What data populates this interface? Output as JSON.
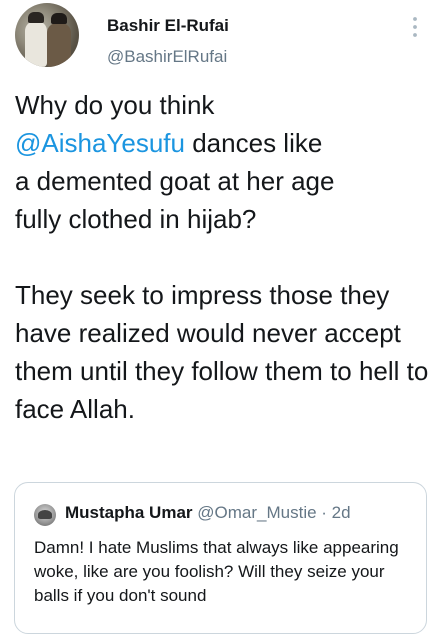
{
  "tweet": {
    "author": {
      "display_name": "Bashir El-Rufai",
      "handle": "@BashirElRufai",
      "avatar_icon": "profile-photo"
    },
    "menu_icon": "more-vertical-icon",
    "text": {
      "line1": "Why do you think",
      "mention": "@AishaYesufu",
      "line2_rest": " dances like",
      "line3": "a demented goat at her age",
      "line4": "fully clothed in hijab?",
      "para2": "They seek to impress those they have realized would never accept them until they follow them to hell to face Allah."
    },
    "mention_color": "#1b95e0"
  },
  "quoted_tweet": {
    "display_name": "Mustapha Umar",
    "handle": "@Omar_Mustie",
    "separator": " · ",
    "time": "2d",
    "text": "Damn! I hate Muslims that always like appearing woke, like are you foolish? Will they seize your balls if you don't sound"
  }
}
